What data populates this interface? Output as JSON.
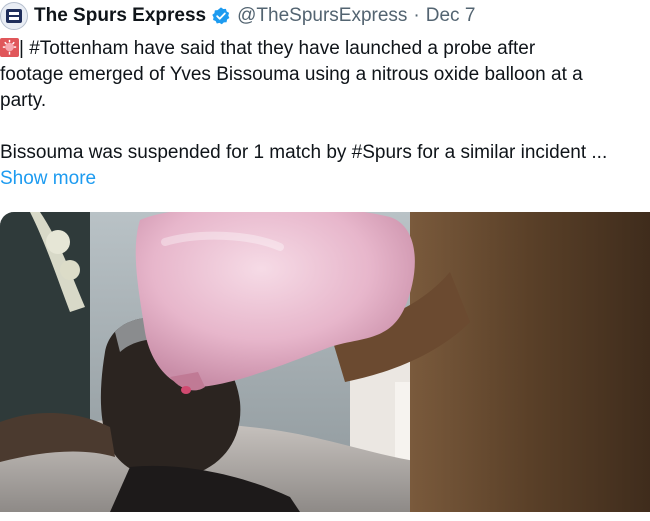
{
  "tweet": {
    "author_name": "The Spurs Express",
    "author_handle": "@TheSpursExpress",
    "separator": "·",
    "date": "Dec 7",
    "emoji": "siren",
    "line1": "| #Tottenham have said that they have launched a probe after",
    "line2": "footage emerged of Yves Bissouma using a nitrous oxide balloon at a",
    "line3": "party.",
    "line4": "Bissouma was suspended for 1 match by #Spurs for a similar incident ...",
    "show_more": "Show more"
  },
  "colors": {
    "link": "#1d9bf0",
    "muted": "#536471",
    "verified": "#1d9bf0"
  }
}
